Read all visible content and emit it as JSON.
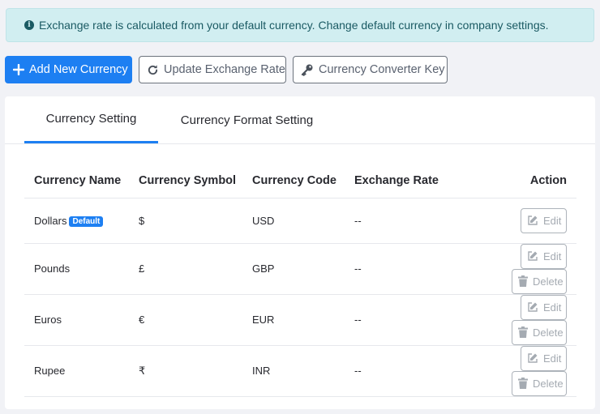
{
  "alert": {
    "text": "Exchange rate is calculated from your default currency. Change default currency in company settings."
  },
  "toolbar": {
    "add_label": "Add New Currency",
    "update_label": "Update Exchange Rate",
    "key_label": "Currency Converter Key"
  },
  "tabs": [
    {
      "label": "Currency Setting",
      "active": true
    },
    {
      "label": "Currency Format Setting",
      "active": false
    }
  ],
  "table": {
    "headers": [
      "Currency Name",
      "Currency Symbol",
      "Currency Code",
      "Exchange Rate",
      "Action"
    ],
    "rows": [
      {
        "name": "Dollars",
        "badge": "Default",
        "symbol": "$",
        "code": "USD",
        "rate": "--",
        "edit": "Edit"
      },
      {
        "name": "Pounds",
        "symbol": "£",
        "code": "GBP",
        "rate": "--",
        "edit": "Edit",
        "delete": "Delete"
      },
      {
        "name": "Euros",
        "symbol": "€",
        "code": "EUR",
        "rate": "--",
        "edit": "Edit",
        "delete": "Delete"
      },
      {
        "name": "Rupee",
        "symbol": "₹",
        "code": "INR",
        "rate": "--",
        "edit": "Edit",
        "delete": "Delete"
      }
    ]
  },
  "colors": {
    "primary": "#1d7ff2",
    "alert_bg": "#d1eef1",
    "page_bg": "#f1f2f6"
  }
}
